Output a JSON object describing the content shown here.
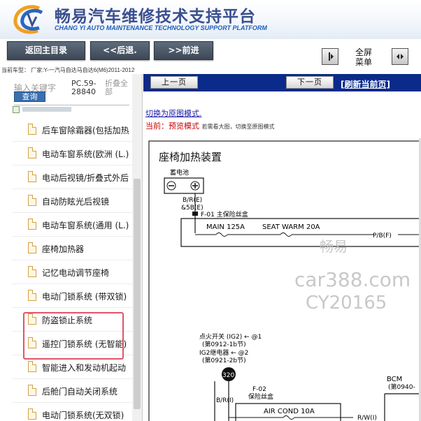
{
  "header": {
    "title": "畅易汽车维修技术支持平台",
    "subtitle": "CHANG YI AUTO MAINTENANCE TECHNOLOGY SUPPORT PLATFORM",
    "logo_letter": "C"
  },
  "nav": {
    "home": "返回主目录",
    "back": "<<后退.",
    "forward": ">>前进",
    "fullscreen_line1": "全屏",
    "fullscreen_line2": "菜单"
  },
  "vehicle_info": "当前车型： 厂家:Y-一汽马自达马自达6(M6)2011-2012",
  "search": {
    "label": "输入关键字",
    "button": "查询",
    "pc_code": "PC.59-28840",
    "scope": "折叠全部"
  },
  "menu": [
    {
      "label": "后车窗除霜器(包括加热"
    },
    {
      "label": "电动车窗系统(欧洲 (L.)"
    },
    {
      "label": "电动后视镜/折叠式外后"
    },
    {
      "label": "自动防眩光后视镜"
    },
    {
      "label": "电动车窗系统(通用 (L.)"
    },
    {
      "label": "座椅加热器"
    },
    {
      "label": "记忆电动调节座椅"
    },
    {
      "label": "电动门锁系统 (带双锁)"
    },
    {
      "label": "防盗锁止系统"
    },
    {
      "label": "遥控门锁系统 (无智能)"
    },
    {
      "label": "智能进入和发动机起动"
    },
    {
      "label": "后舱门自动关闭系统"
    },
    {
      "label": "电动门锁系统(无双锁)"
    }
  ],
  "right": {
    "prev": "上一页",
    "next": "下一页",
    "refresh": "[刷新当前页]",
    "switch_mode": "切换为原图模式.",
    "current_prefix": "当前：",
    "current_mode": "预览模式",
    "current_hint": "若需看大图，切换至原图模式"
  },
  "diagram": {
    "title": "座椅加热装置",
    "battery": "蓄电池",
    "wire_br_e": "B/R(E)",
    "wire_5b_e": "&5B(E)",
    "fuse_box_main": "F-01  主保险丝盒",
    "main_fuse": "MAIN 125A",
    "seat_warm_fuse": "SEAT WARM 20A",
    "wire_pb_f": "P/B(F)",
    "watermark_1": "畅易",
    "watermark_2": "car388.com",
    "watermark_3": "CY20165",
    "ignition_switch": "点火开关 (IG2) ← @1",
    "ignition_ref": "(第0912-1b节)",
    "ig2_relay": "IG2继电器 ← @2",
    "ig2_ref": "(第0921-2b节)",
    "connector_num": "320",
    "fuse_box_f02": "F-02",
    "fuse_box_f02_name": "保险丝盒",
    "wire_br_i": "B/R(I)",
    "aircond_fuse": "AIR COND 10A",
    "bcm": "BCM",
    "bcm_ref": "(第0940-",
    "wire_rw": "R/W(I)"
  }
}
